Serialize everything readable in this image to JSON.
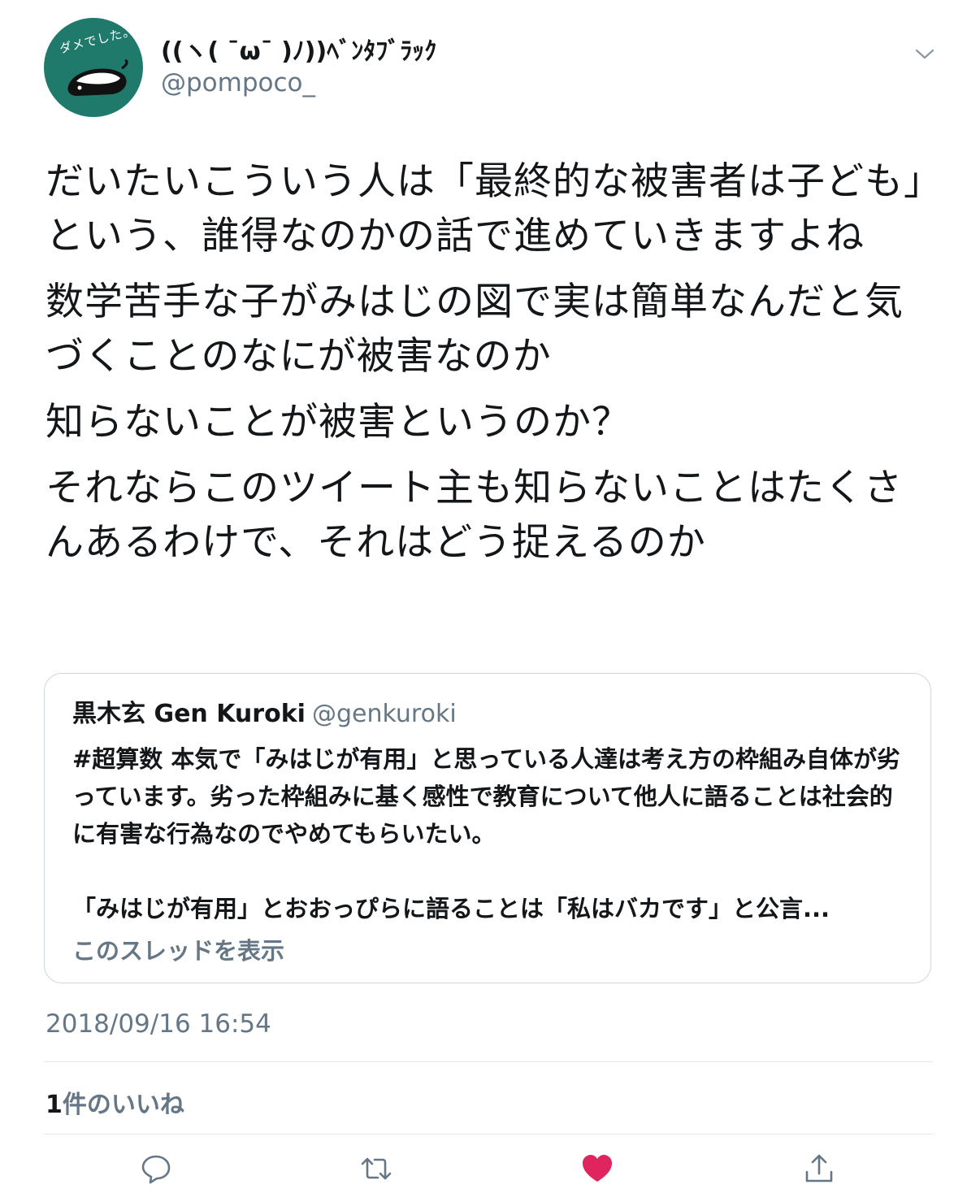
{
  "tweet": {
    "author": {
      "display_name": "((ヽ( ¯ω¯ )ﾉ))ﾍﾞﾝﾀﾌﾞﾗｯｸ",
      "handle": "@pompoco_",
      "avatar_text": "ダメでした。",
      "avatar_color": "#1f7a6b"
    },
    "body": [
      "だいたいこういう人は「最終的な被害者は子ども」という、誰得なのかの話で進めていきますよね",
      "数学苦手な子がみはじの図で実は簡単なんだと気づくことのなにが被害なのか",
      "知らないことが被害というのか？",
      "それならこのツイート主も知らないことはたくさんあるわけで、それはどう捉えるのか"
    ],
    "quote": {
      "name": "黒木玄 Gen Kuroki",
      "handle": "@genkuroki",
      "text_1": "#超算数 本気で「みはじが有用」と思っている人達は考え方の枠組み自体が劣っています。劣った枠組みに基く感性で教育について他人に語ることは社会的に有害な行為なのでやめてもらいたい。",
      "text_2": "「みはじが有用」とおおっぴらに語ることは「私はバカです」と公言...",
      "show_thread": "このスレッドを表示"
    },
    "timestamp": "2018/09/16 16:54",
    "likes": {
      "count": "1",
      "label": "件のいいね"
    },
    "actions": [
      "reply-icon",
      "retweet-icon",
      "like-icon",
      "share-icon"
    ],
    "colors": {
      "text": "#14171a",
      "secondary": "#657786",
      "like": "#e0245e",
      "border": "#ccd6dd"
    }
  }
}
